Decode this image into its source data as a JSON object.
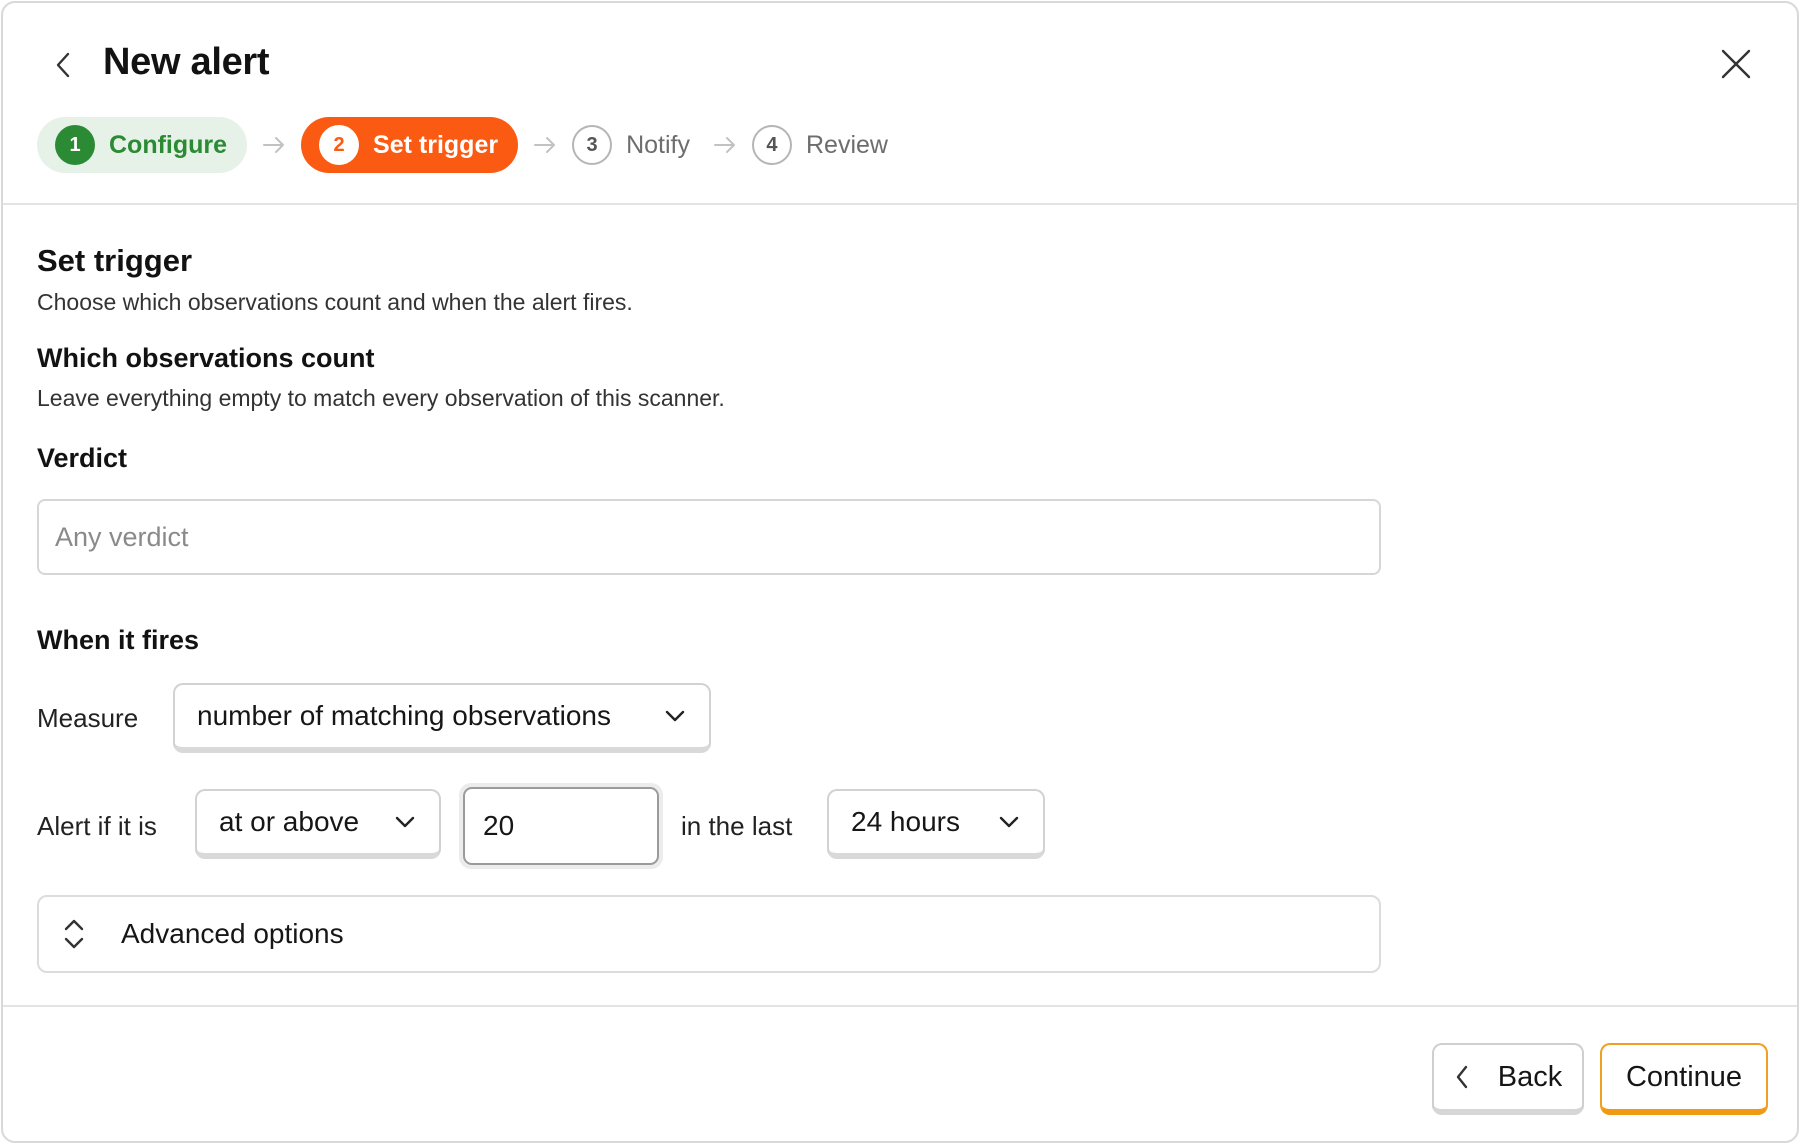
{
  "header": {
    "title": "New alert",
    "back_icon": "chevron-left-icon",
    "close_icon": "close-icon"
  },
  "steps": [
    {
      "number": "1",
      "label": "Configure",
      "state": "done"
    },
    {
      "number": "2",
      "label": "Set trigger",
      "state": "active"
    },
    {
      "number": "3",
      "label": "Notify",
      "state": "upcoming"
    },
    {
      "number": "4",
      "label": "Review",
      "state": "upcoming"
    }
  ],
  "colors": {
    "done": "#2b8a34",
    "active": "#fb5a12",
    "continue_border": "#f0a020"
  },
  "section": {
    "title": "Set trigger",
    "subtitle": "Choose which observations count and when the alert fires."
  },
  "observations": {
    "title": "Which observations count",
    "subtitle": "Leave everything empty to match every observation of this scanner.",
    "verdict_label": "Verdict",
    "verdict_value": "",
    "verdict_placeholder": "Any verdict"
  },
  "fires": {
    "title": "When it fires",
    "measure_label": "Measure",
    "measure_value": "number of matching observations",
    "alert_label": "Alert if it is",
    "comparator_value": "at or above",
    "threshold_value": "20",
    "window_label": "in the last",
    "window_value": "24 hours"
  },
  "advanced": {
    "label": "Advanced options",
    "icon": "expand-collapse-icon"
  },
  "footer": {
    "back_label": "Back",
    "continue_label": "Continue"
  }
}
